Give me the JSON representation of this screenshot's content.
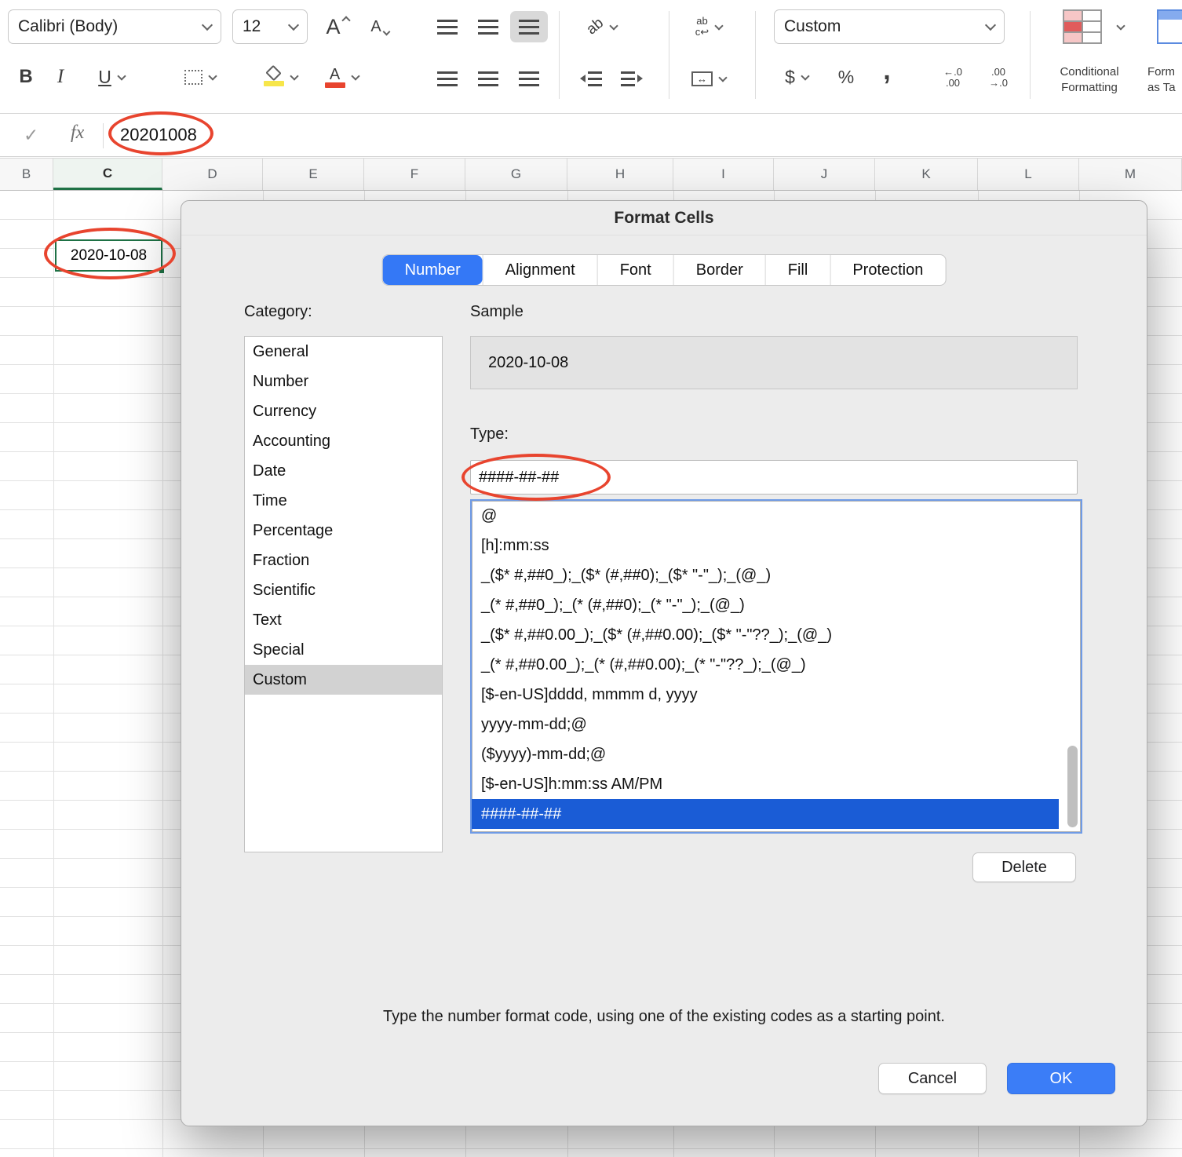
{
  "ribbon": {
    "font_name": "Calibri (Body)",
    "font_size": "12",
    "number_format": "Custom",
    "conditional_formatting_line1": "Conditional",
    "conditional_formatting_line2": "Formatting",
    "format_as_table_line1": "Form",
    "format_as_table_line2": "as Ta",
    "icons": {
      "bold": "B",
      "italic": "I",
      "underline": "U",
      "font_increase": "A",
      "font_decrease": "A",
      "orientation": "ab",
      "wrap_top": "ab",
      "wrap_bottom": "c↩",
      "merge": "↔",
      "dollar": "$",
      "percent": "%",
      "comma": ",",
      "increase_decimal_top": "←.0",
      "increase_decimal_bottom": ".00",
      "decrease_decimal_top": ".00",
      "decrease_decimal_bottom": "→.0"
    }
  },
  "formula_bar": {
    "checkmark": "✓",
    "fx": "fx",
    "value": "20201008"
  },
  "grid": {
    "columns": [
      "B",
      "C",
      "D",
      "E",
      "F",
      "G",
      "H",
      "I",
      "J",
      "K",
      "L",
      "M"
    ],
    "selected_column": "C",
    "selected_cell_value": "2020-10-08"
  },
  "dialog": {
    "title": "Format Cells",
    "tabs": [
      "Number",
      "Alignment",
      "Font",
      "Border",
      "Fill",
      "Protection"
    ],
    "active_tab": "Number",
    "category_label": "Category:",
    "categories": [
      "General",
      "Number",
      "Currency",
      "Accounting",
      "Date",
      "Time",
      "Percentage",
      "Fraction",
      "Scientific",
      "Text",
      "Special",
      "Custom"
    ],
    "selected_category": "Custom",
    "sample_label": "Sample",
    "sample_value": "2020-10-08",
    "type_label": "Type:",
    "type_value": "####-##-##",
    "format_codes": [
      "@",
      "[h]:mm:ss",
      "_($* #,##0_);_($* (#,##0);_($* \"-\"_);_(@_)",
      "_(* #,##0_);_(* (#,##0);_(* \"-\"_);_(@_)",
      "_($* #,##0.00_);_($* (#,##0.00);_($* \"-\"??_);_(@_)",
      "_(* #,##0.00_);_(* (#,##0.00);_(* \"-\"??_);_(@_)",
      "[$-en-US]dddd, mmmm d, yyyy",
      "yyyy-mm-dd;@",
      "($yyyy)-mm-dd;@",
      "[$-en-US]h:mm:ss AM/PM",
      "####-##-##"
    ],
    "selected_format_code": "####-##-##",
    "delete_button": "Delete",
    "help_text": "Type the number format code, using one of the existing codes as a starting point.",
    "cancel_button": "Cancel",
    "ok_button": "OK"
  },
  "colors": {
    "tab_active_blue": "#3478f6",
    "list_selection_blue": "#1a5cd6",
    "ok_button_blue": "#3b7df7",
    "annotation_red": "#e8442e",
    "cell_border_green": "#1e7145",
    "fill_color_yellow": "#f7e64a",
    "font_color_red": "#e8442e"
  }
}
